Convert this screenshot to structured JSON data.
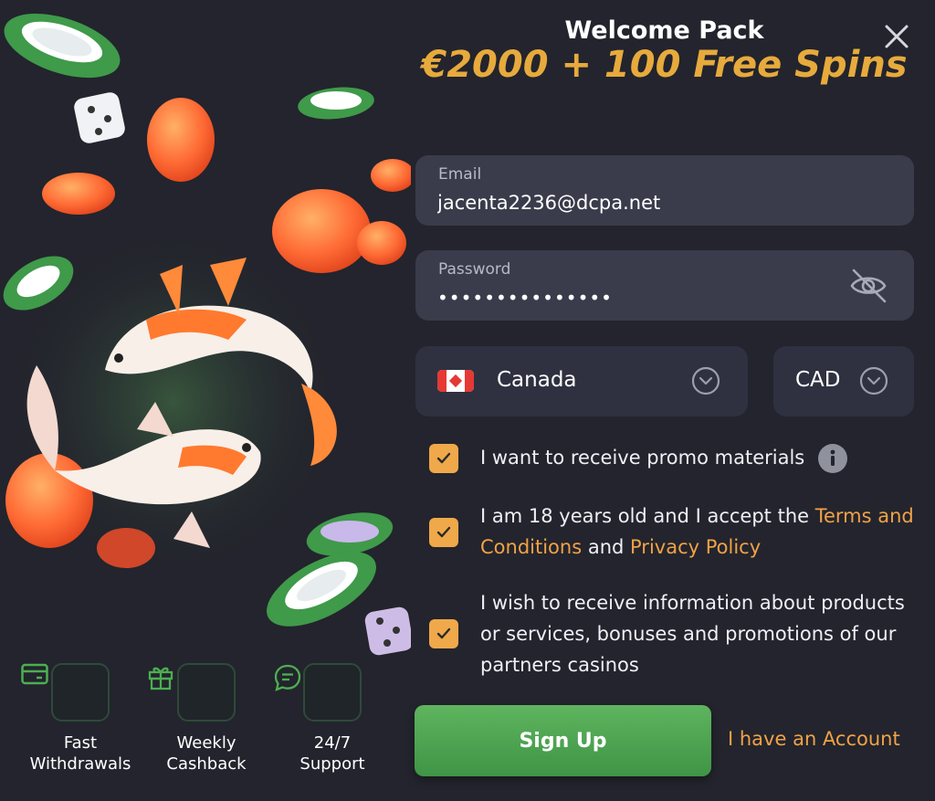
{
  "modal": {
    "title_small": "Welcome Pack",
    "title_big": "€2000 + 100 Free Spins"
  },
  "form": {
    "email": {
      "label": "Email",
      "value": "jacenta2236@dcpa.net"
    },
    "password": {
      "label": "Password",
      "value": "•••••••••••••••"
    },
    "country": {
      "value": "Canada",
      "flag": "canada-flag-icon"
    },
    "currency": {
      "value": "CAD"
    }
  },
  "checkboxes": [
    {
      "checked": true,
      "text": "I want to receive promo materials"
    },
    {
      "checked": true,
      "text_before": "I am 18 years old and I accept the ",
      "link1": "Terms and Conditions",
      "text_mid": " and ",
      "link2": "Privacy Policy"
    },
    {
      "checked": true,
      "text": "I wish to receive information about products or services, bonuses and promotions of our partners casinos"
    }
  ],
  "actions": {
    "signup": "Sign Up",
    "have_account": "I have an Account"
  },
  "features": [
    {
      "icon": "credit-card-icon",
      "label": "Fast\nWithdrawals"
    },
    {
      "icon": "gift-icon",
      "label": "Weekly\nCashback"
    },
    {
      "icon": "chat-bubble-icon",
      "label": "24/7\nSupport"
    }
  ],
  "colors": {
    "background": "#23242d",
    "field": "#3a3c4b",
    "accent_gold": "#e7aa3c",
    "link_orange": "#f1a247",
    "checkbox": "#efa94a",
    "button_green": "#4fa552"
  }
}
